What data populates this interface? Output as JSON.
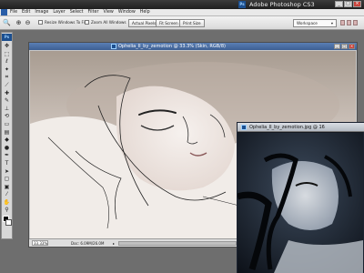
{
  "app": {
    "title": "Adobe Photoshop CS3",
    "logo_text": "Ps"
  },
  "menubar": {
    "items": [
      {
        "label": "File"
      },
      {
        "label": "Edit"
      },
      {
        "label": "Image"
      },
      {
        "label": "Layer"
      },
      {
        "label": "Select"
      },
      {
        "label": "Filter"
      },
      {
        "label": "View"
      },
      {
        "label": "Window"
      },
      {
        "label": "Help"
      }
    ]
  },
  "options": {
    "resize_windows": "Resize Windows To Fit",
    "zoom_all_windows": "Zoom All Windows",
    "actual_pixels": "Actual Pixels",
    "fit_screen": "Fit Screen",
    "print_size": "Print Size",
    "workspace": "Workspace"
  },
  "doc1": {
    "title": "Ophelia_II_by_zemotion @ 33.3% (Skin, RGB/8)",
    "zoom": "33.33%",
    "doc_size": "Doc: 6.09M/26.0M"
  },
  "doc2": {
    "title": "Ophelia_II_by_zemotion.jpg @ 16"
  },
  "toolbox": {
    "tools": [
      "move-tool",
      "marquee-tool",
      "lasso-tool",
      "magic-wand-tool",
      "crop-tool",
      "slice-tool",
      "healing-brush-tool",
      "brush-tool",
      "clone-stamp-tool",
      "history-brush-tool",
      "eraser-tool",
      "gradient-tool",
      "blur-tool",
      "dodge-tool",
      "pen-tool",
      "type-tool",
      "path-selection-tool",
      "shape-tool",
      "notes-tool",
      "eyedropper-tool",
      "hand-tool",
      "zoom-tool"
    ]
  },
  "colors": {
    "foreground": "#000000",
    "background": "#ffffff"
  }
}
